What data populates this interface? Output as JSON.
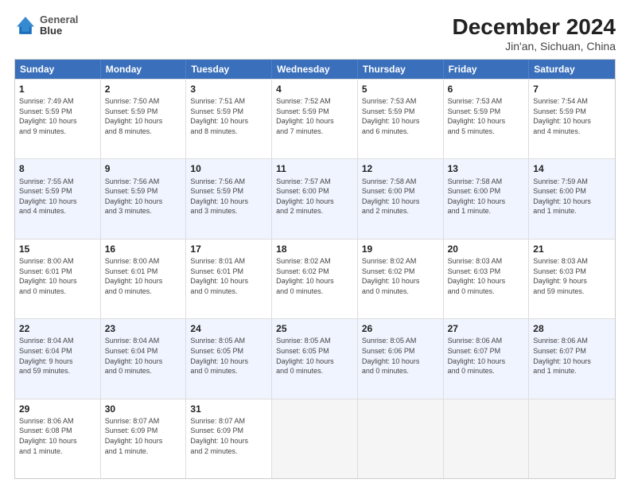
{
  "header": {
    "logo": {
      "line1": "General",
      "line2": "Blue"
    },
    "title": "December 2024",
    "subtitle": "Jin'an, Sichuan, China"
  },
  "weekdays": [
    "Sunday",
    "Monday",
    "Tuesday",
    "Wednesday",
    "Thursday",
    "Friday",
    "Saturday"
  ],
  "rows": [
    [
      {
        "day": "1",
        "info": "Sunrise: 7:49 AM\nSunset: 5:59 PM\nDaylight: 10 hours\nand 9 minutes."
      },
      {
        "day": "2",
        "info": "Sunrise: 7:50 AM\nSunset: 5:59 PM\nDaylight: 10 hours\nand 8 minutes."
      },
      {
        "day": "3",
        "info": "Sunrise: 7:51 AM\nSunset: 5:59 PM\nDaylight: 10 hours\nand 8 minutes."
      },
      {
        "day": "4",
        "info": "Sunrise: 7:52 AM\nSunset: 5:59 PM\nDaylight: 10 hours\nand 7 minutes."
      },
      {
        "day": "5",
        "info": "Sunrise: 7:53 AM\nSunset: 5:59 PM\nDaylight: 10 hours\nand 6 minutes."
      },
      {
        "day": "6",
        "info": "Sunrise: 7:53 AM\nSunset: 5:59 PM\nDaylight: 10 hours\nand 5 minutes."
      },
      {
        "day": "7",
        "info": "Sunrise: 7:54 AM\nSunset: 5:59 PM\nDaylight: 10 hours\nand 4 minutes."
      }
    ],
    [
      {
        "day": "8",
        "info": "Sunrise: 7:55 AM\nSunset: 5:59 PM\nDaylight: 10 hours\nand 4 minutes."
      },
      {
        "day": "9",
        "info": "Sunrise: 7:56 AM\nSunset: 5:59 PM\nDaylight: 10 hours\nand 3 minutes."
      },
      {
        "day": "10",
        "info": "Sunrise: 7:56 AM\nSunset: 5:59 PM\nDaylight: 10 hours\nand 3 minutes."
      },
      {
        "day": "11",
        "info": "Sunrise: 7:57 AM\nSunset: 6:00 PM\nDaylight: 10 hours\nand 2 minutes."
      },
      {
        "day": "12",
        "info": "Sunrise: 7:58 AM\nSunset: 6:00 PM\nDaylight: 10 hours\nand 2 minutes."
      },
      {
        "day": "13",
        "info": "Sunrise: 7:58 AM\nSunset: 6:00 PM\nDaylight: 10 hours\nand 1 minute."
      },
      {
        "day": "14",
        "info": "Sunrise: 7:59 AM\nSunset: 6:00 PM\nDaylight: 10 hours\nand 1 minute."
      }
    ],
    [
      {
        "day": "15",
        "info": "Sunrise: 8:00 AM\nSunset: 6:01 PM\nDaylight: 10 hours\nand 0 minutes."
      },
      {
        "day": "16",
        "info": "Sunrise: 8:00 AM\nSunset: 6:01 PM\nDaylight: 10 hours\nand 0 minutes."
      },
      {
        "day": "17",
        "info": "Sunrise: 8:01 AM\nSunset: 6:01 PM\nDaylight: 10 hours\nand 0 minutes."
      },
      {
        "day": "18",
        "info": "Sunrise: 8:02 AM\nSunset: 6:02 PM\nDaylight: 10 hours\nand 0 minutes."
      },
      {
        "day": "19",
        "info": "Sunrise: 8:02 AM\nSunset: 6:02 PM\nDaylight: 10 hours\nand 0 minutes."
      },
      {
        "day": "20",
        "info": "Sunrise: 8:03 AM\nSunset: 6:03 PM\nDaylight: 10 hours\nand 0 minutes."
      },
      {
        "day": "21",
        "info": "Sunrise: 8:03 AM\nSunset: 6:03 PM\nDaylight: 9 hours\nand 59 minutes."
      }
    ],
    [
      {
        "day": "22",
        "info": "Sunrise: 8:04 AM\nSunset: 6:04 PM\nDaylight: 9 hours\nand 59 minutes."
      },
      {
        "day": "23",
        "info": "Sunrise: 8:04 AM\nSunset: 6:04 PM\nDaylight: 10 hours\nand 0 minutes."
      },
      {
        "day": "24",
        "info": "Sunrise: 8:05 AM\nSunset: 6:05 PM\nDaylight: 10 hours\nand 0 minutes."
      },
      {
        "day": "25",
        "info": "Sunrise: 8:05 AM\nSunset: 6:05 PM\nDaylight: 10 hours\nand 0 minutes."
      },
      {
        "day": "26",
        "info": "Sunrise: 8:05 AM\nSunset: 6:06 PM\nDaylight: 10 hours\nand 0 minutes."
      },
      {
        "day": "27",
        "info": "Sunrise: 8:06 AM\nSunset: 6:07 PM\nDaylight: 10 hours\nand 0 minutes."
      },
      {
        "day": "28",
        "info": "Sunrise: 8:06 AM\nSunset: 6:07 PM\nDaylight: 10 hours\nand 1 minute."
      }
    ],
    [
      {
        "day": "29",
        "info": "Sunrise: 8:06 AM\nSunset: 6:08 PM\nDaylight: 10 hours\nand 1 minute."
      },
      {
        "day": "30",
        "info": "Sunrise: 8:07 AM\nSunset: 6:09 PM\nDaylight: 10 hours\nand 1 minute."
      },
      {
        "day": "31",
        "info": "Sunrise: 8:07 AM\nSunset: 6:09 PM\nDaylight: 10 hours\nand 2 minutes."
      },
      {
        "day": "",
        "info": ""
      },
      {
        "day": "",
        "info": ""
      },
      {
        "day": "",
        "info": ""
      },
      {
        "day": "",
        "info": ""
      }
    ]
  ]
}
